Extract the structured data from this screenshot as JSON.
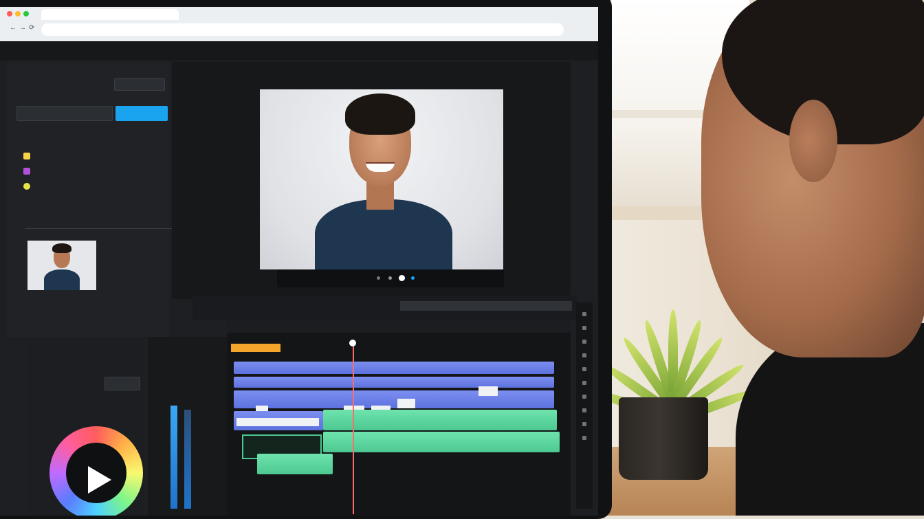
{
  "browser": {
    "tab_title": "",
    "url": "",
    "nav": {
      "back": "←",
      "forward": "→",
      "reload": "⟳"
    }
  },
  "app": {
    "menu": [
      "",
      "",
      "",
      "",
      "",
      "",
      "",
      ""
    ]
  },
  "left_panel": {
    "header": "",
    "field1_label": "",
    "field1_value": "",
    "field2_label": "",
    "action_button": "",
    "section_title": "",
    "items": [
      "",
      "",
      ""
    ],
    "media_title": ""
  },
  "preview": {
    "label": "",
    "caption_line1": "",
    "caption_line2": ""
  },
  "timeline": {
    "label": "",
    "layer_tag": ""
  },
  "bottom_left": {
    "title": "",
    "item": "",
    "button": ""
  },
  "colors": {
    "accent_blue": "#1aa3ee",
    "track_blue": "#6a7ff0",
    "track_green": "#55d29b",
    "playhead": "#ff6b6b",
    "marker_orange": "#f4a52c"
  },
  "icons": [
    "back-icon",
    "forward-icon",
    "reload-icon",
    "play-icon",
    "color-wheel-icon"
  ]
}
